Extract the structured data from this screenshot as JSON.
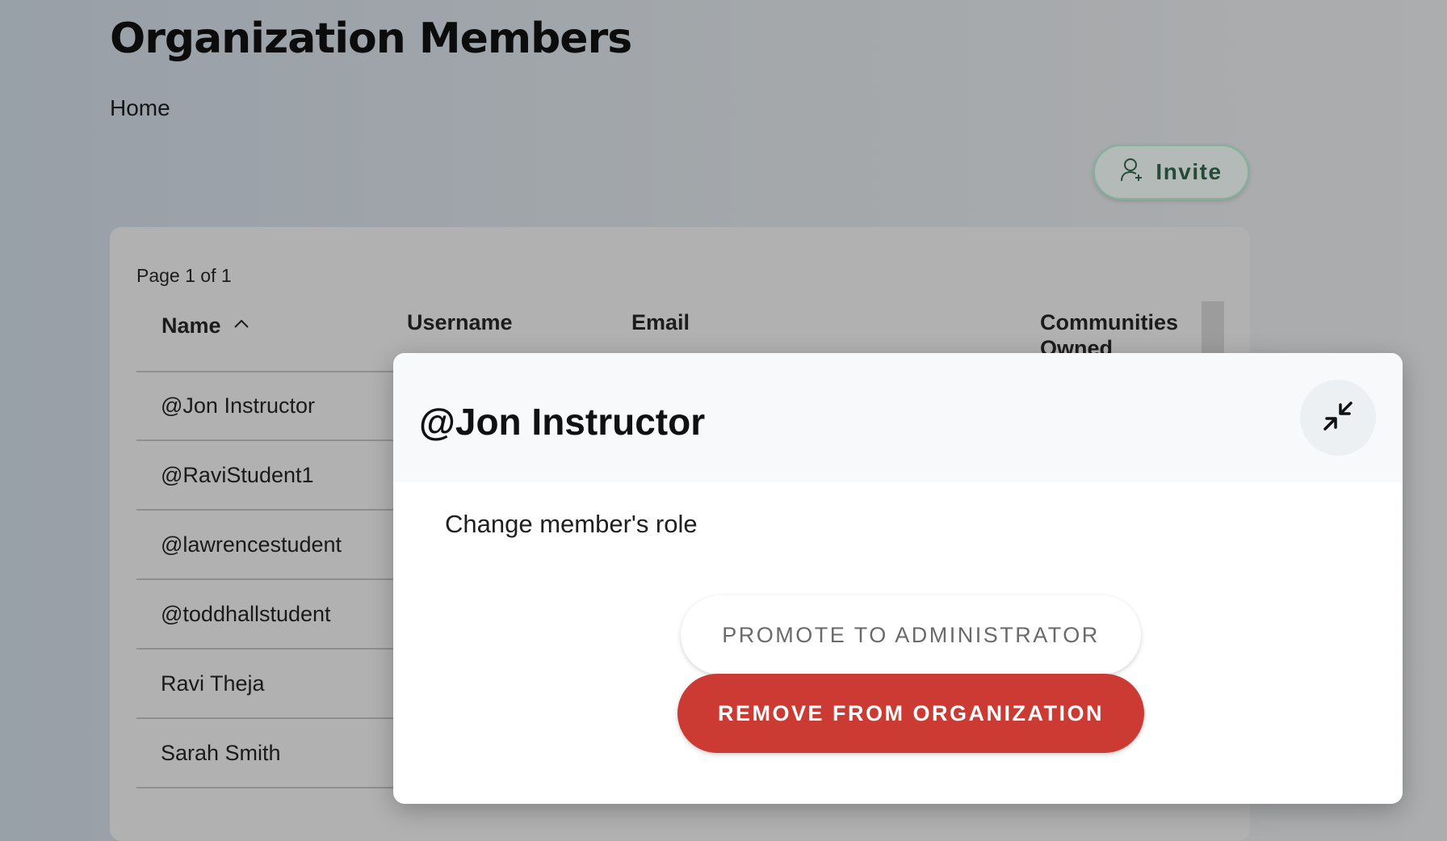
{
  "page": {
    "title": "Organization Members",
    "breadcrumb": "Home",
    "invite_label": "Invite"
  },
  "table": {
    "page_info": "Page 1 of 1",
    "columns": {
      "name": "Name",
      "username": "Username",
      "email": "Email",
      "communities_owned": "Communities Owned"
    },
    "sort": {
      "column": "Name",
      "direction": "ascending"
    },
    "rows": [
      {
        "name": "@Jon Instructor"
      },
      {
        "name": "@RaviStudent1"
      },
      {
        "name": "@lawrencestudent"
      },
      {
        "name": "@toddhallstudent"
      },
      {
        "name": "Ravi Theja"
      },
      {
        "name": "Sarah Smith"
      }
    ]
  },
  "modal": {
    "title": "@Jon Instructor",
    "subtitle": "Change member's role",
    "promote_label": "PROMOTE TO ADMINISTRATOR",
    "remove_label": "REMOVE FROM ORGANIZATION",
    "collapse_icon": "collapse-icon"
  },
  "colors": {
    "accent_green": "#7fb39a",
    "danger_red": "#cc3b33"
  }
}
